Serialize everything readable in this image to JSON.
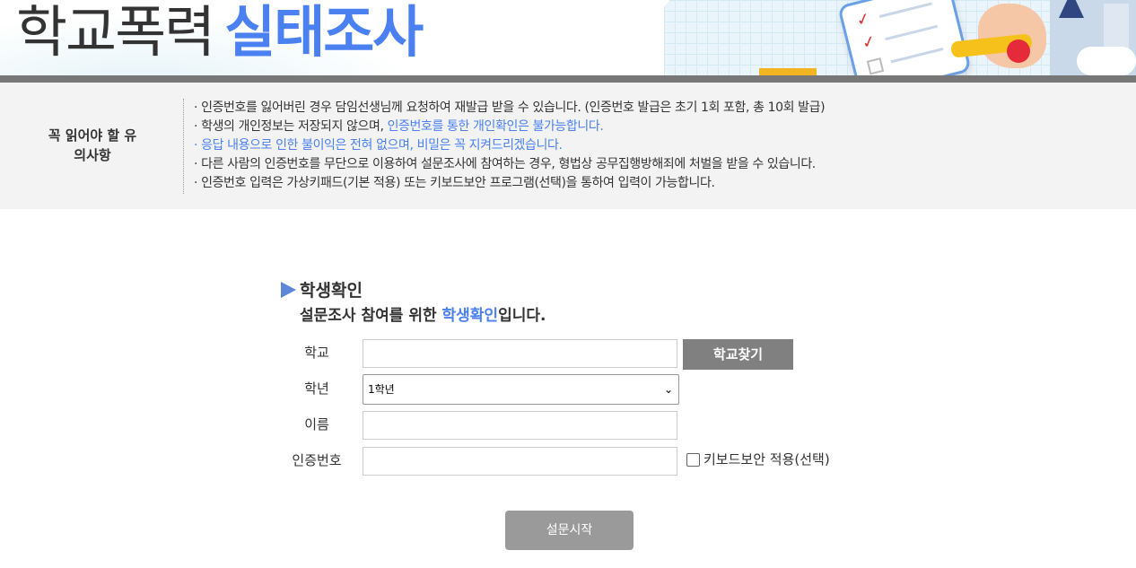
{
  "header": {
    "title_part1": "학교폭력",
    "title_part2": "실태조사"
  },
  "notice": {
    "label_line1": "꼭 읽어야 할 유",
    "label_line2": "의사항",
    "items": [
      "· 인증번호를 잃어버린 경우 담임선생님께 요청하여 재발급 받을 수 있습니다. (인증번호 발급은 초기 1회 포함, 총 10회 발급)",
      "· 학생의 개인정보는 저장되지 않으며, ",
      "인증번호를 통한 개인확인은 불가능합니다.",
      "· 응답 내용으로 인한 불이익은 전혀 없으며, 비밀은 꼭 지켜드리겠습니다.",
      "· 다른 사람의 인증번호를 무단으로 이용하여 설문조사에 참여하는 경우, 형법상 공무집행방해죄에 처벌을 받을 수 있습니다.",
      "· 인증번호 입력은 가상키패드(기본 적용) 또는 키보드보안 프로그램(선택)을 통하여 입력이 가능합니다."
    ]
  },
  "form": {
    "title": "학생확인",
    "subtitle_pre": "설문조사 참여를 위한 ",
    "subtitle_highlight": "학생확인",
    "subtitle_post": "입니다.",
    "school_label": "학교",
    "school_value": "",
    "find_school_button": "학교찾기",
    "grade_label": "학년",
    "grade_selected": "1학년",
    "name_label": "이름",
    "name_value": "",
    "auth_label": "인증번호",
    "auth_value": "",
    "keyboard_security_label": "키보드보안 적용(선택)",
    "keyboard_security_checked": false,
    "start_button": "설문시작"
  },
  "colors": {
    "accent": "#4a80f0",
    "button_gray": "#808080",
    "start_button": "#9a9a9a",
    "divider": "#777777"
  },
  "icons": {
    "title_arrow": "triangle-right-icon",
    "select_arrow": "chevron-down-icon"
  }
}
